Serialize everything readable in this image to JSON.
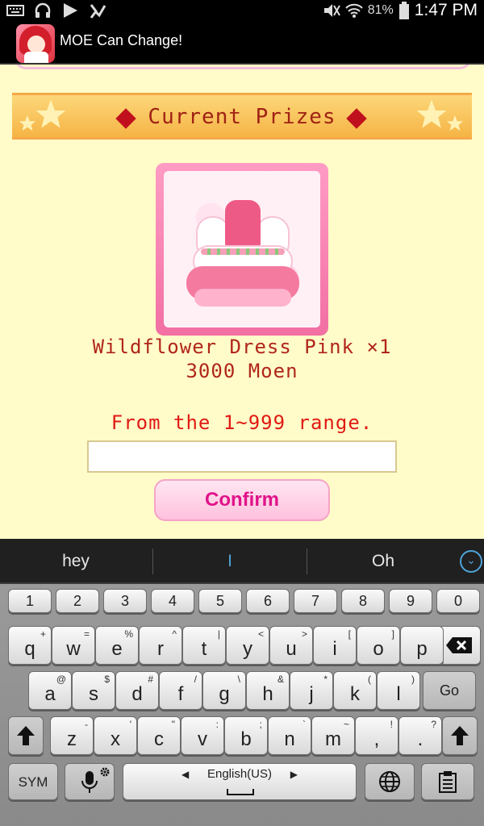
{
  "status_bar": {
    "icons": [
      "keyboard-icon",
      "headphones-icon",
      "play-icon",
      "checkmark-icon",
      "mute-icon",
      "wifi-icon",
      "battery-icon"
    ],
    "battery_pct": "81%",
    "time": "1:47 PM"
  },
  "app": {
    "title": "MOE Can Change!"
  },
  "game": {
    "banner_title": "Current Prizes",
    "prize_name": "Wildflower Dress Pink ×1",
    "prize_cost": "3000 Moen",
    "range_hint": "From the 1~999 range.",
    "input_value": "",
    "confirm_label": "Confirm",
    "colors": {
      "background": "#fffcc9",
      "accent_text": "#b0261a",
      "button_text": "#e0138a"
    }
  },
  "suggestions": {
    "left": "hey",
    "middle": "I",
    "right": "Oh"
  },
  "keyboard": {
    "numbers": [
      "1",
      "2",
      "3",
      "4",
      "5",
      "6",
      "7",
      "8",
      "9",
      "0"
    ],
    "row1": [
      {
        "k": "q",
        "s": "+"
      },
      {
        "k": "w",
        "s": "="
      },
      {
        "k": "e",
        "s": "%"
      },
      {
        "k": "r",
        "s": "^"
      },
      {
        "k": "t",
        "s": "|"
      },
      {
        "k": "y",
        "s": "<"
      },
      {
        "k": "u",
        "s": ">"
      },
      {
        "k": "i",
        "s": "["
      },
      {
        "k": "o",
        "s": "]"
      },
      {
        "k": "p",
        "s": ""
      }
    ],
    "row2": [
      {
        "k": "a",
        "s": "@"
      },
      {
        "k": "s",
        "s": "$"
      },
      {
        "k": "d",
        "s": "#"
      },
      {
        "k": "f",
        "s": "/"
      },
      {
        "k": "g",
        "s": "\\"
      },
      {
        "k": "h",
        "s": "&"
      },
      {
        "k": "j",
        "s": "*"
      },
      {
        "k": "k",
        "s": "("
      },
      {
        "k": "l",
        "s": ")"
      }
    ],
    "row3": [
      {
        "k": "z",
        "s": "-"
      },
      {
        "k": "x",
        "s": "'"
      },
      {
        "k": "c",
        "s": "\""
      },
      {
        "k": "v",
        "s": ":"
      },
      {
        "k": "b",
        "s": ";"
      },
      {
        "k": "n",
        "s": "`"
      },
      {
        "k": "m",
        "s": "~"
      },
      {
        "k": ",",
        "s": "!"
      },
      {
        "k": ".",
        "s": "?"
      }
    ],
    "go_label": "Go",
    "sym_label": "SYM",
    "space_label": "English(US)"
  }
}
